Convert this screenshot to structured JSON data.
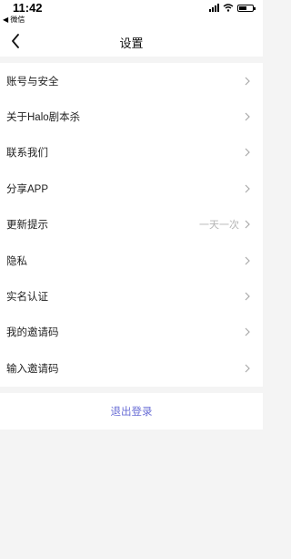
{
  "status_bar": {
    "time": "11:42",
    "back_to_app": "◀ 微信",
    "battery_level": 0.55
  },
  "nav": {
    "title": "设置",
    "back_icon": "chevron-left-icon"
  },
  "settings": {
    "items": [
      {
        "label": "账号与安全",
        "value": ""
      },
      {
        "label": "关于Halo剧本杀",
        "value": ""
      },
      {
        "label": "联系我们",
        "value": ""
      },
      {
        "label": "分享APP",
        "value": ""
      },
      {
        "label": "更新提示",
        "value": "一天一次"
      },
      {
        "label": "隐私",
        "value": ""
      },
      {
        "label": "实名认证",
        "value": ""
      },
      {
        "label": "我的邀请码",
        "value": ""
      },
      {
        "label": "输入邀请码",
        "value": ""
      }
    ]
  },
  "logout": {
    "label": "退出登录"
  },
  "colors": {
    "accent": "#6b6fd6",
    "background": "#f4f4f4",
    "secondary_text": "#b5b5b5"
  }
}
